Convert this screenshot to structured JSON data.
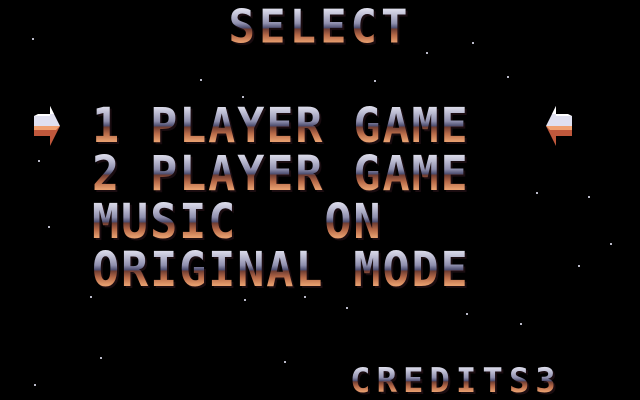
{
  "screen": {
    "title": "SELECT",
    "menu": {
      "items": [
        {
          "label": "1 PLAYER GAME",
          "selected": true
        },
        {
          "label": "2 PLAYER GAME",
          "selected": false
        },
        {
          "label": "MUSIC   ON",
          "selected": false
        },
        {
          "label": "ORIGINAL MODE",
          "selected": false
        }
      ]
    },
    "credits": "CREDITS3"
  },
  "icons": {
    "cursor_left": "arrow-right-icon",
    "cursor_right": "arrow-left-icon"
  },
  "colors": {
    "background": "#000000",
    "chrome_light": "#f2f2fa",
    "chrome_dark": "#4c4c6e",
    "copper_light": "#e8a070",
    "copper_dark": "#a84830",
    "star": "#b9b9c8"
  }
}
